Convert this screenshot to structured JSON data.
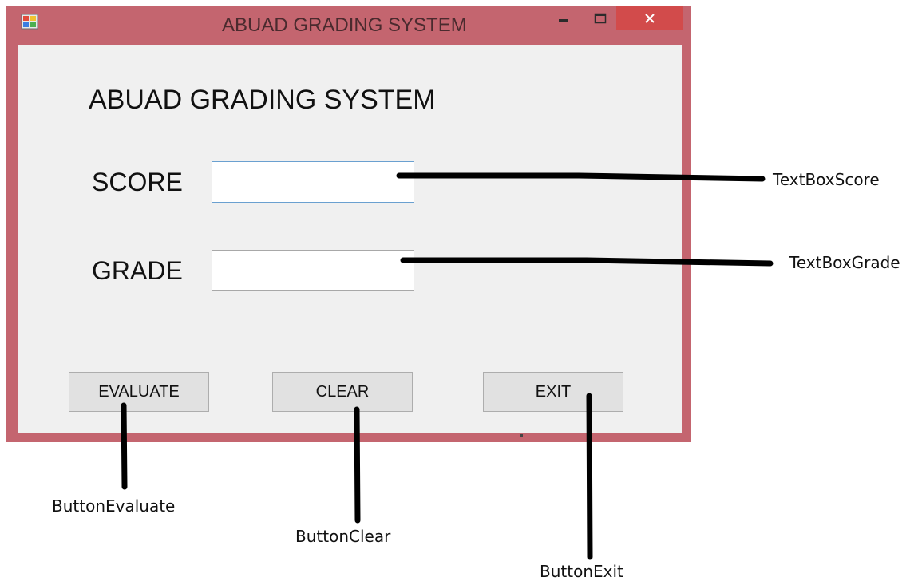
{
  "window": {
    "title": "ABUAD GRADING SYSTEM",
    "controls": {
      "minimize": "–",
      "maximize": "☐",
      "close": "✕"
    },
    "colors": {
      "frame": "#c4656f",
      "close": "#d24b4b",
      "client": "#f0f0f0"
    }
  },
  "form": {
    "heading": "ABUAD GRADING SYSTEM",
    "score_label": "SCORE",
    "score_value": "",
    "grade_label": "GRADE",
    "grade_value": "",
    "buttons": {
      "evaluate": "EVALUATE",
      "clear": "CLEAR",
      "exit": "EXIT"
    }
  },
  "annotations": {
    "textbox_score": "TextBoxScore",
    "textbox_grade": "TextBoxGrade",
    "button_evaluate": "ButtonEvaluate",
    "button_clear": "ButtonClear",
    "button_exit": "ButtonExit"
  }
}
